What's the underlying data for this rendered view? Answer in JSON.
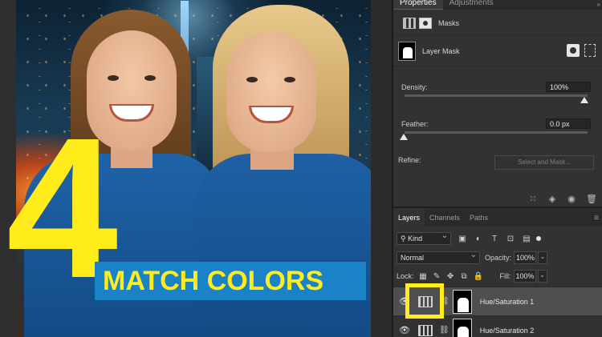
{
  "thumbnail": {
    "number": "4",
    "headline": "MATCH COLORS"
  },
  "properties_panel": {
    "tabs": [
      "Properties",
      "Adjustments"
    ],
    "masks_label": "Masks",
    "layer_mask_label": "Layer Mask",
    "density_label": "Density:",
    "density_value": "100%",
    "feather_label": "Feather:",
    "feather_value": "0.0 px",
    "refine_label": "Refine:",
    "select_and_mask_label": "Select and Mask..."
  },
  "layers_panel": {
    "tabs": [
      "Layers",
      "Channels",
      "Paths"
    ],
    "filter_kind": "Kind",
    "blend_mode": "Normal",
    "opacity_label": "Opacity:",
    "opacity_value": "100%",
    "lock_label": "Lock:",
    "fill_label": "Fill:",
    "fill_value": "100%",
    "layers": [
      {
        "name": "Hue/Saturation 1",
        "selected": true
      },
      {
        "name": "Hue/Saturation 2",
        "selected": false
      }
    ]
  },
  "icons": {
    "filter": [
      "image-filter-icon",
      "adjustment-filter-icon",
      "type-filter-icon",
      "shape-filter-icon",
      "smart-object-filter-icon"
    ],
    "lock": [
      "lock-transparent-icon",
      "lock-pixels-icon",
      "lock-position-icon",
      "lock-artboard-icon",
      "lock-all-icon"
    ],
    "footer": [
      "mask-selection-icon",
      "clip-to-layer-icon",
      "visibility-icon",
      "delete-icon"
    ]
  },
  "colors": {
    "accent_yellow": "#ffec1a",
    "banner_blue": "#1a83c8",
    "panel_bg": "#323232",
    "selected_row": "#4f4f4f"
  }
}
